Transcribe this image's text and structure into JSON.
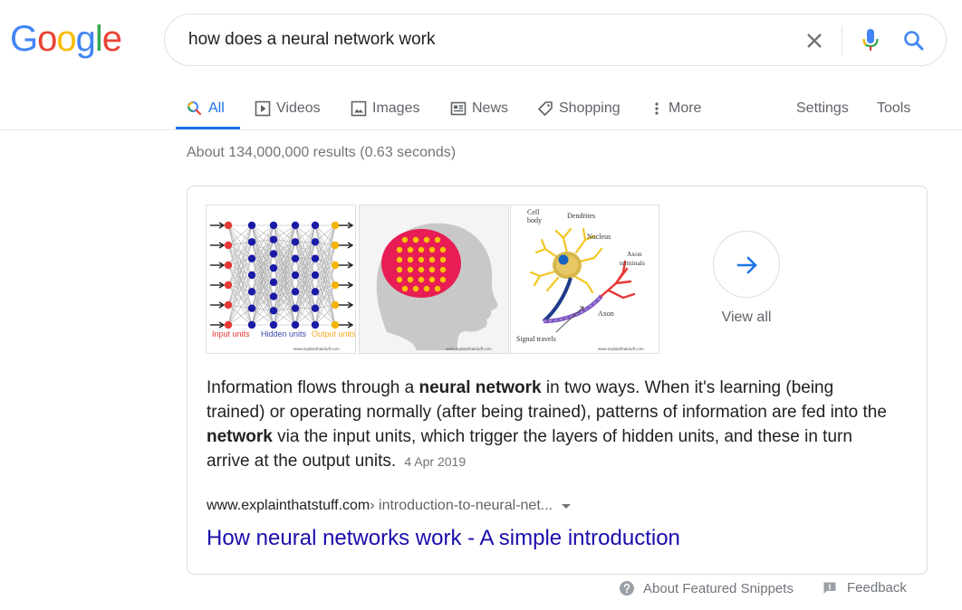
{
  "logo": {
    "letters": [
      {
        "char": "G",
        "color": "#4285F4"
      },
      {
        "char": "o",
        "color": "#EA4335"
      },
      {
        "char": "o",
        "color": "#FBBC05"
      },
      {
        "char": "g",
        "color": "#4285F4"
      },
      {
        "char": "l",
        "color": "#34A853"
      },
      {
        "char": "e",
        "color": "#EA4335"
      }
    ]
  },
  "search": {
    "query": "how does a neural network work",
    "clear_icon": "close-icon",
    "mic_icon": "microphone-icon",
    "search_icon": "search-icon"
  },
  "tabs": {
    "all": "All",
    "videos": "Videos",
    "images": "Images",
    "news": "News",
    "shopping": "Shopping",
    "more": "More",
    "settings": "Settings",
    "tools": "Tools",
    "active": "all"
  },
  "results": {
    "stats": "About 134,000,000 results (0.63 seconds)"
  },
  "featured_snippet": {
    "images": {
      "img1": {
        "input_label": "Input units",
        "hidden_label": "Hidden units",
        "output_label": "Output units",
        "watermark": "www.explainthatstuff.com"
      },
      "img2": {
        "watermark": "www.explainthatstuff.com"
      },
      "img3": {
        "cell_body": "Cell body",
        "dendrites": "Dendrites",
        "nucleus": "Nucleus",
        "axon_terminals": "Axon terminals",
        "axon": "Axon",
        "signal": "Signal travels",
        "watermark": "www.explainthatstuff.com"
      }
    },
    "view_all": "View all",
    "text": {
      "p1": "Information flows through a ",
      "b1": "neural network",
      "p2": " in two ways. When it's learning (being trained) or operating normally (after being trained), patterns of information are fed into the ",
      "b2": "network",
      "p3": " via the input units, which trigger the layers of hidden units, and these in turn arrive at the output units.",
      "date": "4 Apr 2019"
    },
    "cite": {
      "domain": "www.explainthatstuff.com",
      "path": " › introduction-to-neural-net..."
    },
    "title": "How neural networks work - A simple introduction"
  },
  "footer": {
    "about_snippets": "About Featured Snippets",
    "feedback": "Feedback"
  },
  "colors": {
    "accent": "#1a73e8",
    "link": "#1a0dab",
    "muted": "#70757a"
  }
}
